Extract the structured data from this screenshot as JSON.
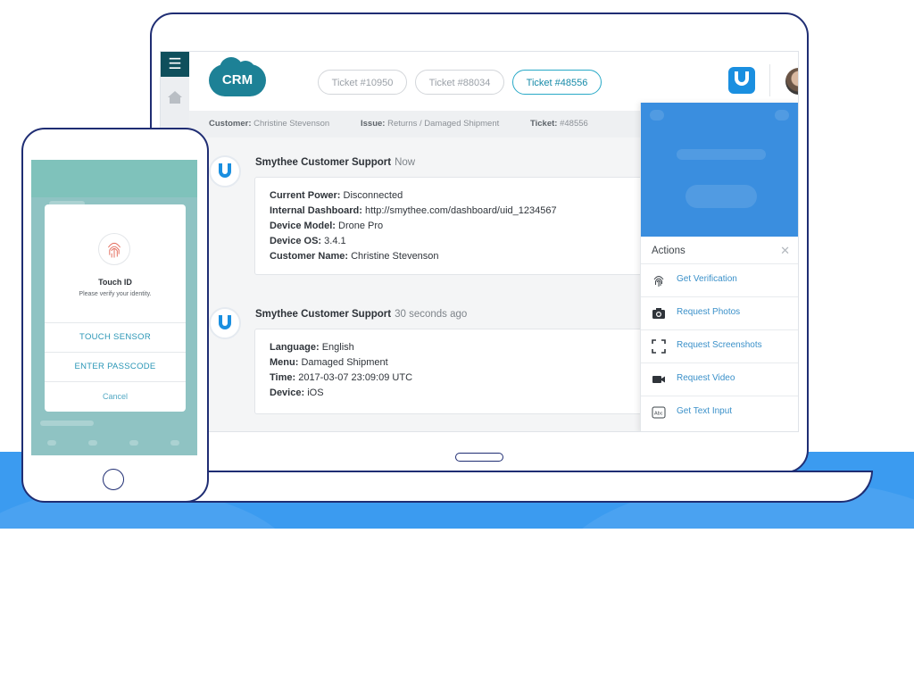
{
  "crm": {
    "label": "CRM"
  },
  "tickets": [
    {
      "label": "Ticket #10950",
      "active": false
    },
    {
      "label": "Ticket #88034",
      "active": false
    },
    {
      "label": "Ticket #48556",
      "active": true
    }
  ],
  "infobar": {
    "customer_key": "Customer:",
    "customer_value": "Christine Stevenson",
    "issue_key": "Issue:",
    "issue_value": "Returns / Damaged Shipment",
    "ticket_key": "Ticket:",
    "ticket_value": "#48556"
  },
  "messages": [
    {
      "sender": "Smythee Customer Support",
      "time": "Now",
      "rows": [
        {
          "key": "Current Power:",
          "value": "Disconnected"
        },
        {
          "key": "Internal Dashboard:",
          "value": "http://smythee.com/dashboard/uid_1234567"
        },
        {
          "key": "Device Model:",
          "value": "Drone Pro"
        },
        {
          "key": "Device OS:",
          "value": "3.4.1"
        },
        {
          "key": "Customer Name:",
          "value": "Christine Stevenson"
        }
      ]
    },
    {
      "sender": "Smythee Customer Support",
      "time": "30 seconds ago",
      "rows": [
        {
          "key": "Language:",
          "value": "English"
        },
        {
          "key": "Menu:",
          "value": "Damaged Shipment"
        },
        {
          "key": "Time:",
          "value": "2017-03-07 23:09:09 UTC"
        },
        {
          "key": "Device:",
          "value": "iOS"
        }
      ]
    }
  ],
  "actions": {
    "title": "Actions",
    "items": [
      {
        "label": "Get Verification",
        "icon": "fingerprint-icon"
      },
      {
        "label": "Request Photos",
        "icon": "camera-icon"
      },
      {
        "label": "Request Screenshots",
        "icon": "screenshot-icon"
      },
      {
        "label": "Request Video",
        "icon": "video-icon"
      },
      {
        "label": "Get Text Input",
        "icon": "text-input-icon"
      }
    ]
  },
  "touch_id": {
    "title": "Touch ID",
    "subtitle": "Please verify your identity.",
    "sensor_label": "TOUCH SENSOR",
    "passcode_label": "ENTER PASSCODE",
    "cancel_label": "Cancel"
  },
  "colors": {
    "brand_blue": "#1a8fe0",
    "crm_teal": "#1d8196",
    "menu_dark_teal": "#0f4f5c",
    "background_blue": "#3b9bf0",
    "device_outline": "#1f2d73"
  }
}
